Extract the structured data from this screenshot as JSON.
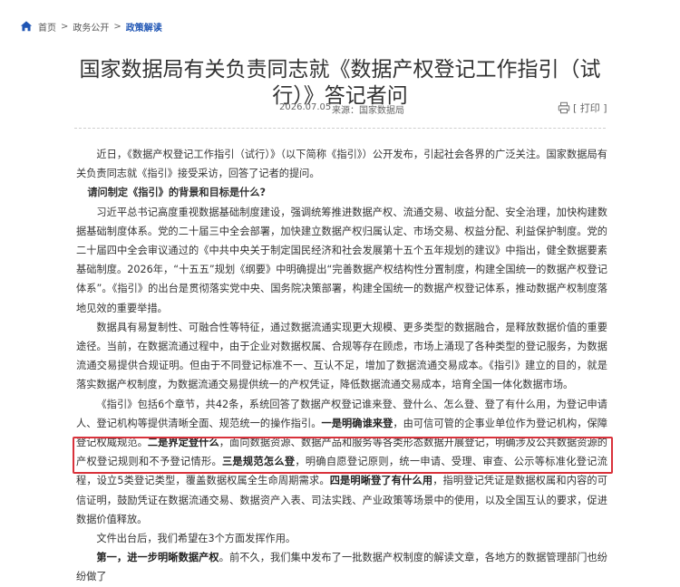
{
  "breadcrumb": {
    "home": "首页",
    "category": "政务公开",
    "current": "政策解读",
    "separator": ">"
  },
  "article": {
    "title": "国家数据局有关负责同志就《数据产权登记工作指引（试行）》答记者问",
    "date": "2026.07.05",
    "source": "来源：国家数据局",
    "print_label": "[ 打印 ]",
    "intro": "近日，《数据产权登记工作指引（试行）》（以下简称《指引》）公开发布，引起社会各界的广泛关注。国家数据局有关负责同志就《指引》接受采访，回答了记者的提问。",
    "question1": "请问制定《指引》的背景和目标是什么?",
    "p1": "习近平总书记高度重视数据基础制度建设，强调统筹推进数据产权、流通交易、收益分配、安全治理，加快构建数据基础制度体系。党的二十届三中全会部署，加快建立数据产权归属认定、市场交易、权益分配、利益保护制度。党的二十届四中全会审议通过的《中共中央关于制定国民经济和社会发展第十五个五年规划的建议》中指出，健全数据要素基础制度。2026年，“十五五”规划《纲要》中明确提出“完善数据产权结构性分置制度，构建全国统一的数据产权登记体系”。《指引》的出台是贯彻落实党中央、国务院决策部署，构建全国统一的数据产权登记体系，推动数据产权制度落地见效的重要举措。",
    "p2": "数据具有易复制性、可融合性等特征，通过数据流通实现更大规模、更多类型的数据融合，是释放数据价值的重要途径。当前，在数据流通过程中，由于企业对数据权属、合规等存在顾虑，市场上涌现了各种类型的登记服务，为数据流通交易提供合规证明。但由于不同登记标准不一、互认不足，增加了数据流通交易成本。《指引》建立的目的，就是落实数据产权制度，为数据流通交易提供统一的产权凭证，降低数据流通交易成本，培育全国一体化数据市场。",
    "p3_a": "《指引》包括6个章节，共42条，系统回答了数据产权登记谁来登、登什么、怎么登、登了有什么用，为登记申请人、登记机构等提供清晰全面、规范统一的操作指引。",
    "p3_b1": "一是明确谁来登",
    "p3_c": "，由可信可管的企事业单位作为登记机构，保障登记权威规范。",
    "p3_b2": "二是界定登什么",
    "p3_d": "，面向数据资源、数据产品和服务等各类形态数据开展登记，明确涉及公共数据资源的产权登记规则和不予登记情形。",
    "p3_b3": "三是规范怎么登",
    "p3_e": "，明确自愿登记原则，统一申请、受理、审查、公示等标准化登记流程，设立5类登记类型，覆盖数据权属全生命周期需求。",
    "p3_b4": "四是明晰登了有什么用",
    "p3_f": "，指明登记凭证是数据权属和内容的可信证明，鼓励凭证在数据流通交易、数据资产入表、司法实践、产业政策等场景中的使用，以及全国互认的要求，促进数据价值释放。",
    "p4": "文件出台后，我们希望在3个方面发挥作用。",
    "p5_b": "第一，进一步明晰数据产权",
    "p5_rest": "。前不久，我们集中发布了一批数据产权制度的解读文章，各地方的数据管理部门也纷纷做了"
  }
}
